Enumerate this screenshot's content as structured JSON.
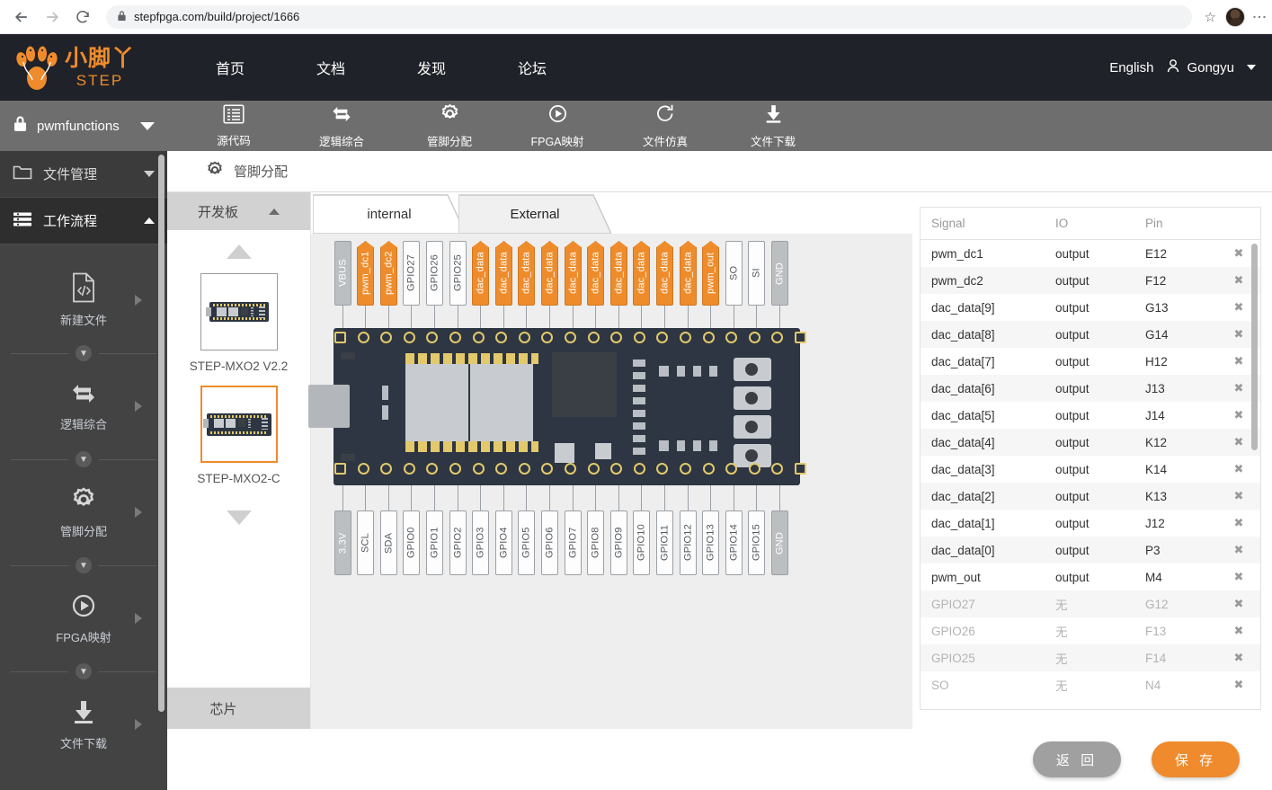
{
  "browser": {
    "url": "stepfpga.com/build/project/1666",
    "back_icon": "back-arrow-icon",
    "forward_icon": "forward-arrow-icon",
    "reload_icon": "reload-icon",
    "lock_icon": "lock-icon",
    "star_icon": "star-icon",
    "menu_icon": "kebab-menu-icon"
  },
  "header": {
    "brand_cn": "小脚丫",
    "brand_en": "STEP",
    "nav": [
      {
        "label": "首页",
        "name": "nav-home"
      },
      {
        "label": "文档",
        "name": "nav-docs"
      },
      {
        "label": "发现",
        "name": "nav-discover"
      },
      {
        "label": "论坛",
        "name": "nav-forum"
      }
    ],
    "language": "English",
    "user": "Gongyu"
  },
  "sidebar": {
    "project": "pwmfunctions",
    "sections": [
      {
        "label": "文件管理",
        "icon": "folder-icon",
        "expanded": false
      },
      {
        "label": "工作流程",
        "icon": "list-icon",
        "expanded": true
      }
    ],
    "flow": [
      {
        "label": "新建文件",
        "icon": "new-file-icon"
      },
      {
        "label": "逻辑综合",
        "icon": "synthesis-icon"
      },
      {
        "label": "管脚分配",
        "icon": "gear-icon"
      },
      {
        "label": "FPGA映射",
        "icon": "play-circle-icon"
      },
      {
        "label": "文件下载",
        "icon": "download-icon"
      }
    ]
  },
  "toolbar": {
    "items": [
      {
        "label": "源代码",
        "icon": "source-code-icon"
      },
      {
        "label": "逻辑综合",
        "icon": "synthesis-icon"
      },
      {
        "label": "管脚分配",
        "icon": "gear-icon"
      },
      {
        "label": "FPGA映射",
        "icon": "play-circle-icon"
      },
      {
        "label": "文件仿真",
        "icon": "simulation-icon"
      },
      {
        "label": "文件下载",
        "icon": "download-icon"
      }
    ]
  },
  "page_title": "管脚分配",
  "board_panel": {
    "head": "开发板",
    "foot": "芯片",
    "boards": [
      {
        "name": "STEP-MXO2 V2.2",
        "selected": false
      },
      {
        "name": "STEP-MXO2-C",
        "selected": true
      }
    ]
  },
  "tabs": [
    {
      "label": "internal",
      "active": true
    },
    {
      "label": "External",
      "active": false
    }
  ],
  "pins": {
    "top": [
      {
        "label": "VBUS",
        "style": "dark"
      },
      {
        "label": "pwm_dc1",
        "style": "orange"
      },
      {
        "label": "pwm_dc2",
        "style": "orange"
      },
      {
        "label": "GPIO27",
        "style": "gray"
      },
      {
        "label": "GPIO26",
        "style": "gray"
      },
      {
        "label": "GPIO25",
        "style": "gray"
      },
      {
        "label": "dac_data",
        "style": "orange"
      },
      {
        "label": "dac_data",
        "style": "orange"
      },
      {
        "label": "dac_data",
        "style": "orange"
      },
      {
        "label": "dac_data",
        "style": "orange"
      },
      {
        "label": "dac_data",
        "style": "orange"
      },
      {
        "label": "dac_data",
        "style": "orange"
      },
      {
        "label": "dac_data",
        "style": "orange"
      },
      {
        "label": "dac_data",
        "style": "orange"
      },
      {
        "label": "dac_data",
        "style": "orange"
      },
      {
        "label": "dac_data",
        "style": "orange"
      },
      {
        "label": "pwm_out",
        "style": "orange"
      },
      {
        "label": "SO",
        "style": "gray"
      },
      {
        "label": "SI",
        "style": "gray"
      },
      {
        "label": "GND",
        "style": "dark"
      }
    ],
    "bottom": [
      {
        "label": "3.3V",
        "style": "dark"
      },
      {
        "label": "SCL",
        "style": "gray"
      },
      {
        "label": "SDA",
        "style": "gray"
      },
      {
        "label": "GPIO0",
        "style": "gray"
      },
      {
        "label": "GPIO1",
        "style": "gray"
      },
      {
        "label": "GPIO2",
        "style": "gray"
      },
      {
        "label": "GPIO3",
        "style": "gray"
      },
      {
        "label": "GPIO4",
        "style": "gray"
      },
      {
        "label": "GPIO5",
        "style": "gray"
      },
      {
        "label": "GPIO6",
        "style": "gray"
      },
      {
        "label": "GPIO7",
        "style": "gray"
      },
      {
        "label": "GPIO8",
        "style": "gray"
      },
      {
        "label": "GPIO9",
        "style": "gray"
      },
      {
        "label": "GPIO10",
        "style": "gray"
      },
      {
        "label": "GPIO11",
        "style": "gray"
      },
      {
        "label": "GPIO12",
        "style": "gray"
      },
      {
        "label": "GPIO13",
        "style": "gray"
      },
      {
        "label": "GPIO14",
        "style": "gray"
      },
      {
        "label": "GPIO15",
        "style": "gray"
      },
      {
        "label": "GND",
        "style": "dark"
      }
    ]
  },
  "signal_table": {
    "columns": [
      "Signal",
      "IO",
      "Pin"
    ],
    "remove_icon": "close-icon",
    "rows": [
      {
        "signal": "pwm_dc1",
        "io": "output",
        "pin": "E12",
        "muted": false
      },
      {
        "signal": "pwm_dc2",
        "io": "output",
        "pin": "F12",
        "muted": false
      },
      {
        "signal": "dac_data[9]",
        "io": "output",
        "pin": "G13",
        "muted": false
      },
      {
        "signal": "dac_data[8]",
        "io": "output",
        "pin": "G14",
        "muted": false
      },
      {
        "signal": "dac_data[7]",
        "io": "output",
        "pin": "H12",
        "muted": false
      },
      {
        "signal": "dac_data[6]",
        "io": "output",
        "pin": "J13",
        "muted": false
      },
      {
        "signal": "dac_data[5]",
        "io": "output",
        "pin": "J14",
        "muted": false
      },
      {
        "signal": "dac_data[4]",
        "io": "output",
        "pin": "K12",
        "muted": false
      },
      {
        "signal": "dac_data[3]",
        "io": "output",
        "pin": "K14",
        "muted": false
      },
      {
        "signal": "dac_data[2]",
        "io": "output",
        "pin": "K13",
        "muted": false
      },
      {
        "signal": "dac_data[1]",
        "io": "output",
        "pin": "J12",
        "muted": false
      },
      {
        "signal": "dac_data[0]",
        "io": "output",
        "pin": "P3",
        "muted": false
      },
      {
        "signal": "pwm_out",
        "io": "output",
        "pin": "M4",
        "muted": false
      },
      {
        "signal": "GPIO27",
        "io": "无",
        "pin": "G12",
        "muted": true
      },
      {
        "signal": "GPIO26",
        "io": "无",
        "pin": "F13",
        "muted": true
      },
      {
        "signal": "GPIO25",
        "io": "无",
        "pin": "F14",
        "muted": true
      },
      {
        "signal": "SO",
        "io": "无",
        "pin": "N4",
        "muted": true
      }
    ]
  },
  "footer": {
    "back": "返 回",
    "save": "保 存"
  },
  "colors": {
    "accent": "#ef8b2c",
    "header_bg": "#1f2228",
    "sidebar_bg": "#434343",
    "toolbar_bg": "#6e6e6e",
    "canvas_bg": "#eeeeee",
    "pcb": "#2d3642"
  }
}
